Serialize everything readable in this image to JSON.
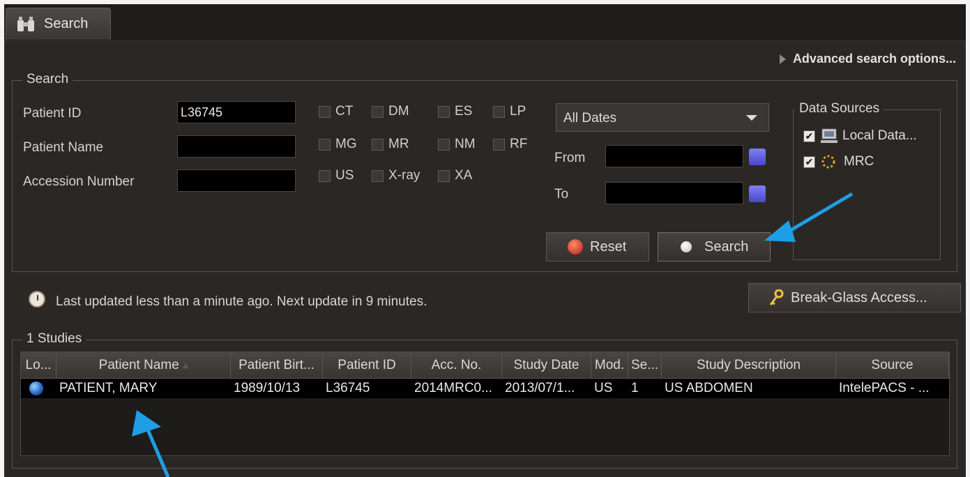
{
  "tab": {
    "label": "Search",
    "icon": "binoculars-icon"
  },
  "advanced_search_label": "Advanced search options...",
  "search_group": {
    "title": "Search",
    "patient_id_label": "Patient ID",
    "patient_id_value": "L36745",
    "patient_name_label": "Patient Name",
    "patient_name_value": "",
    "accession_label": "Accession Number",
    "accession_value": "",
    "modalities": [
      "CT",
      "DM",
      "ES",
      "LP",
      "MG",
      "MR",
      "NM",
      "RF",
      "US",
      "X-ray",
      "XA"
    ],
    "date_range": "All Dates",
    "from_label": "From",
    "to_label": "To",
    "reset_label": "Reset",
    "search_label": "Search"
  },
  "data_sources": {
    "title": "Data Sources",
    "items": [
      {
        "label": "Local Data...",
        "checked": true,
        "icon": "computer-icon"
      },
      {
        "label": "MRC",
        "checked": true,
        "icon": "spinner-icon"
      }
    ]
  },
  "status_text": "Last updated less than a minute ago. Next update in 9 minutes.",
  "break_glass_label": "Break-Glass Access...",
  "studies": {
    "title": "1 Studies",
    "columns": [
      "Lo...",
      "Patient Name",
      "Patient Birt...",
      "Patient ID",
      "Acc. No.",
      "Study Date",
      "Mod.",
      "Se...",
      "Study Description",
      "Source"
    ],
    "rows": [
      [
        "",
        "PATIENT, MARY",
        "1989/10/13",
        "L36745",
        "2014MRC0...",
        "2013/07/1...",
        "US",
        "1",
        "US ABDOMEN",
        "IntelePACS - ..."
      ]
    ]
  },
  "colors": {
    "background": "#2a2725",
    "field": "#000000",
    "annotation_arrow": "#1e9ee4"
  }
}
